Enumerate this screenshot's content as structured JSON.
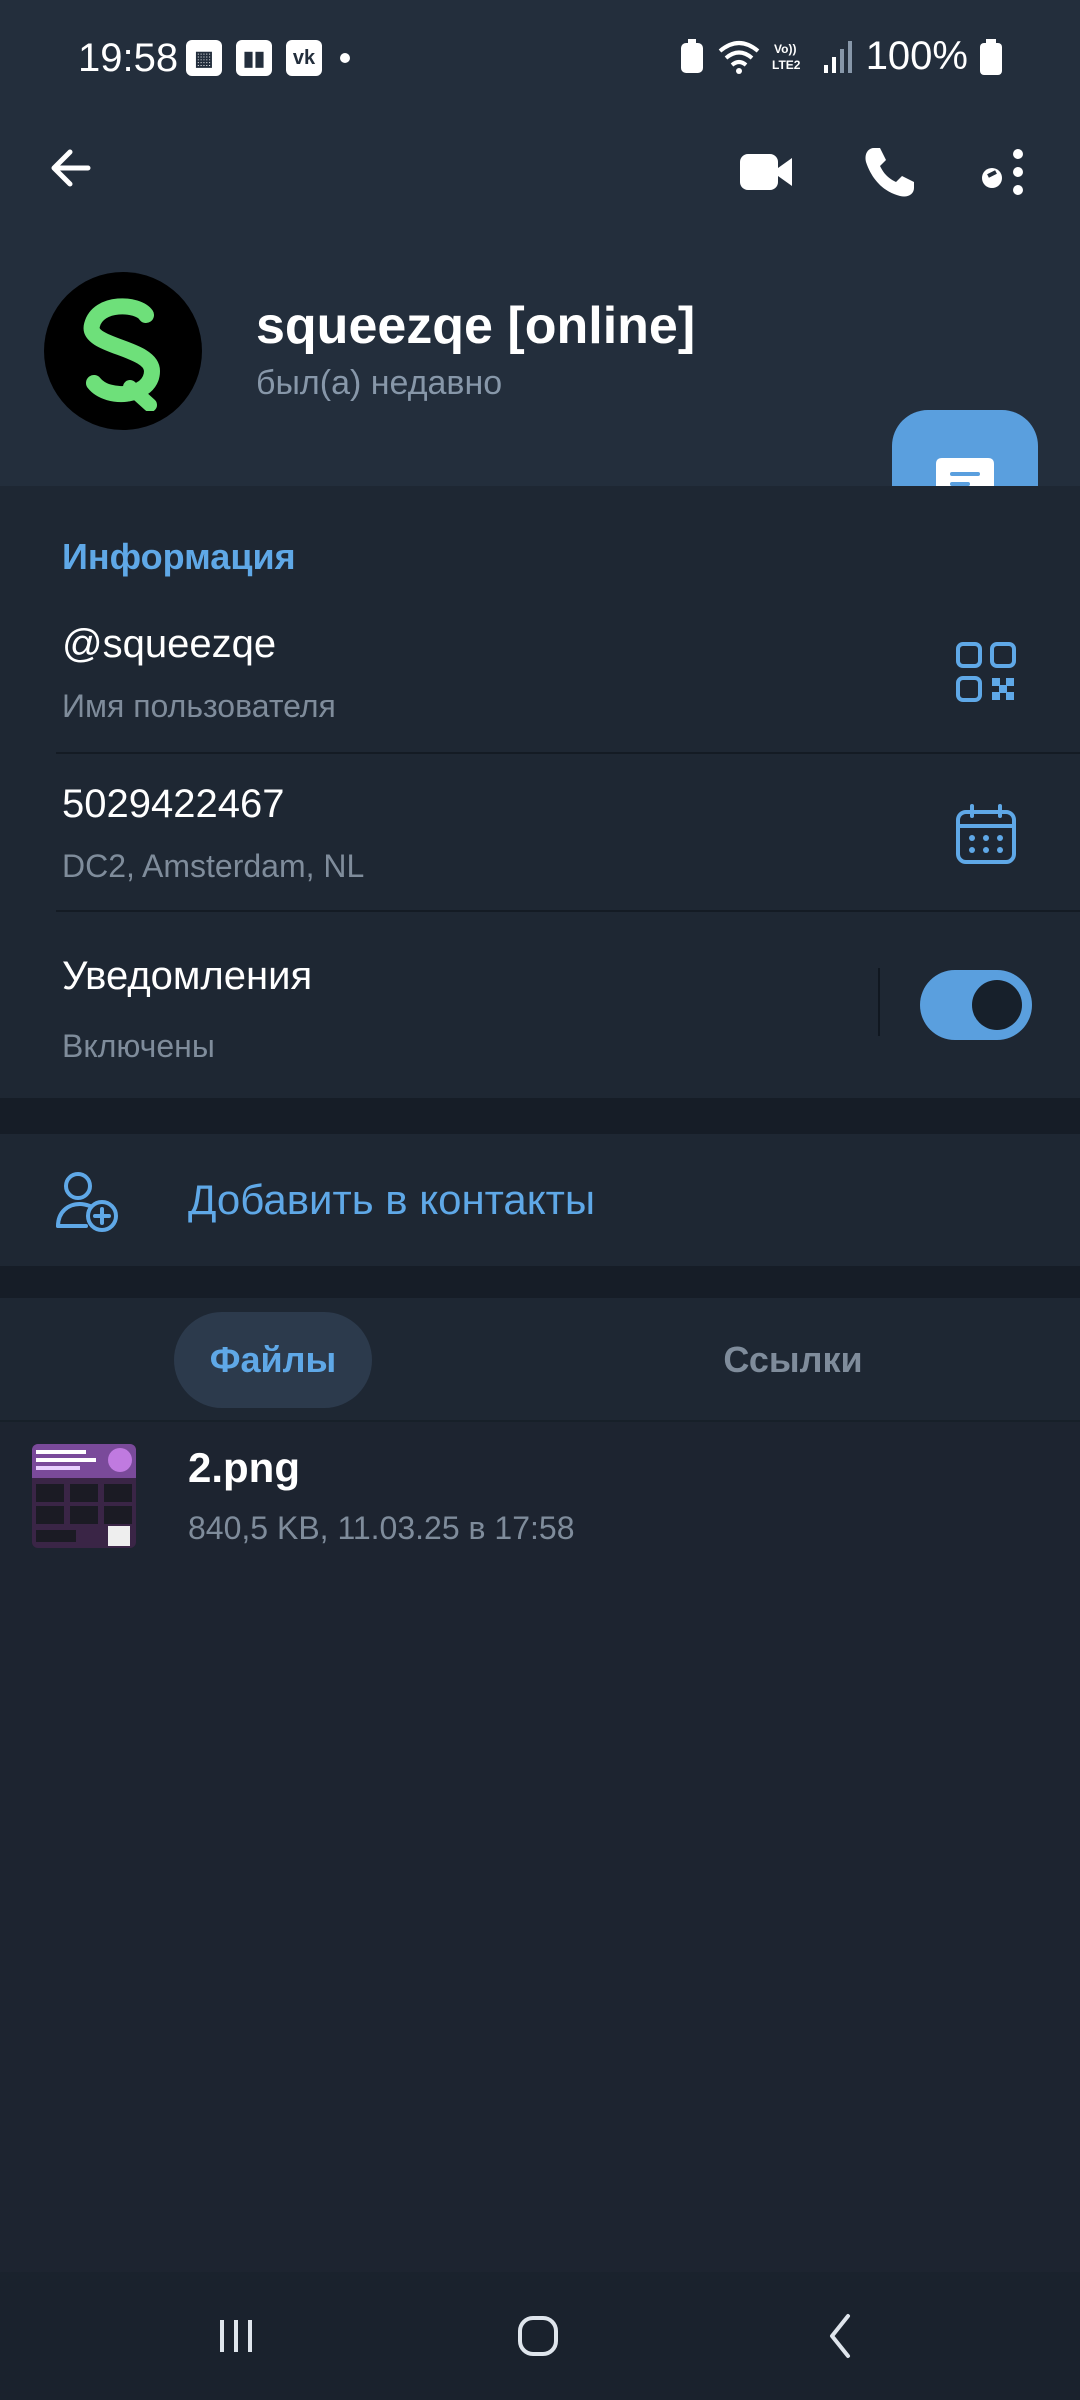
{
  "status_bar": {
    "time": "19:58",
    "battery": "100%",
    "icons": [
      "image-icon",
      "twitch-icon",
      "vk-icon",
      "dot-icon",
      "battery-saver-icon",
      "wifi-icon",
      "lte-icon",
      "signal-icon",
      "battery-icon"
    ]
  },
  "header": {
    "back_icon": "arrow-left-icon",
    "actions": [
      "video-call-icon",
      "phone-icon",
      "more-icon"
    ]
  },
  "profile": {
    "avatar_letter": "S",
    "name": "squeezqe [online]",
    "status": "был(а) недавно"
  },
  "fab": {
    "icon": "message-icon"
  },
  "info": {
    "section_title": "Информация",
    "username": "@squeezqe",
    "username_label": "Имя пользователя",
    "id": "5029422467",
    "dc": "DC2, Amsterdam, NL",
    "notifications_label": "Уведомления",
    "notifications_state": "Включены",
    "notifications_on": true
  },
  "add_contact": {
    "label": "Добавить в контакты"
  },
  "tabs": [
    {
      "label": "Файлы",
      "active": true
    },
    {
      "label": "Ссылки",
      "active": false
    }
  ],
  "files": [
    {
      "name": "2.png",
      "meta": "840,5 KB, 11.03.25 в 17:58"
    }
  ],
  "colors": {
    "accent": "#5fa8e7",
    "background": "#1d2430",
    "header": "#232e3c",
    "avatar_green": "#6ee07a"
  }
}
